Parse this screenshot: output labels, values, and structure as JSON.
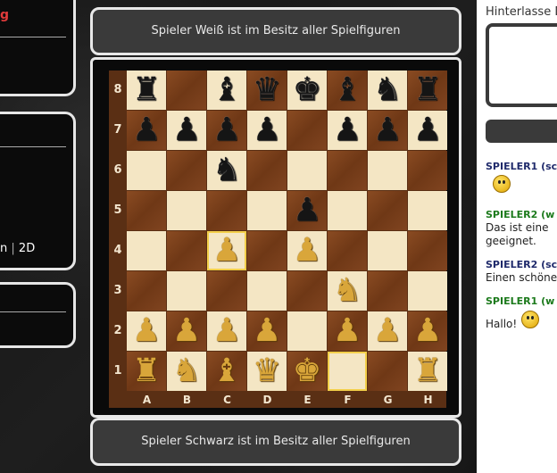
{
  "left": {
    "top_label": "g",
    "mode_partial": "n",
    "mode_separator": "|",
    "mode_2d": "2D"
  },
  "board": {
    "status_top": "Spieler Weiß ist im Besitz aller Spielfiguren",
    "status_bottom": "Spieler Schwarz ist im Besitz aller Spielfiguren",
    "files": [
      "A",
      "B",
      "C",
      "D",
      "E",
      "F",
      "G",
      "H"
    ],
    "ranks": [
      "8",
      "7",
      "6",
      "5",
      "4",
      "3",
      "2",
      "1"
    ],
    "highlight_squares": [
      "c4",
      "f1"
    ],
    "pieces": {
      "a8": "bR",
      "c8": "bB",
      "d8": "bQ",
      "e8": "bK",
      "f8": "bB",
      "g8": "bN",
      "h8": "bR",
      "a7": "bP",
      "b7": "bP",
      "c7": "bP",
      "d7": "bP",
      "f7": "bP",
      "g7": "bP",
      "h7": "bP",
      "c6": "bN",
      "e5": "bP",
      "c4": "wP",
      "e4": "wP",
      "f3": "wN",
      "a2": "wP",
      "b2": "wP",
      "c2": "wP",
      "d2": "wP",
      "f2": "wP",
      "g2": "wP",
      "h2": "wP",
      "a1": "wR",
      "b1": "wN",
      "c1": "wB",
      "d1": "wQ",
      "e1": "wK",
      "h1": "wR"
    }
  },
  "chat": {
    "title": "Hinterlasse D",
    "input_value": "",
    "messages": [
      {
        "author": "SPIELER1 (sc",
        "color": "navy",
        "text": "",
        "smiley": true
      },
      {
        "author": "SPIELER2 (w",
        "color": "green",
        "text": "Das ist eine",
        "text2": "geeignet.",
        "smiley": false
      },
      {
        "author": "SPIELER2 (sc",
        "color": "navy",
        "text": "Einen schöne",
        "smiley": false
      },
      {
        "author": "SPIELER1 (w",
        "color": "green",
        "text": "Hallo!",
        "smiley": true
      }
    ]
  }
}
